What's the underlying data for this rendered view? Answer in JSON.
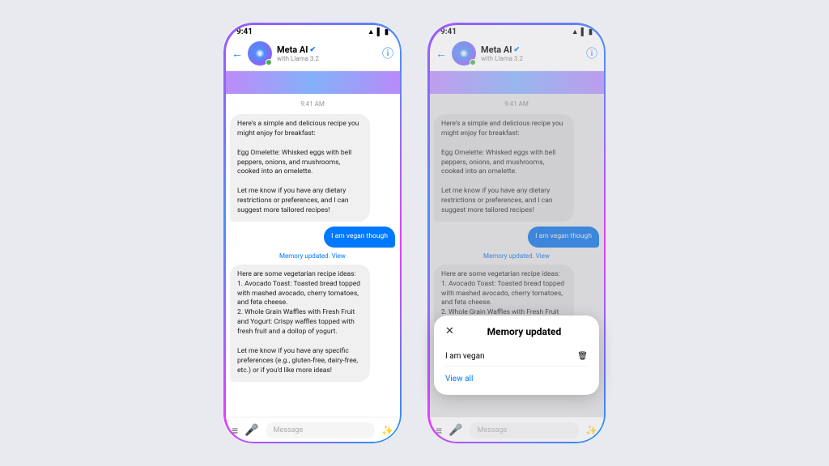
{
  "left_phone": {
    "status_time": "9:41",
    "header": {
      "name": "Meta AI",
      "sub": "with Llama 3.2",
      "back_label": "←",
      "info_label": "ⓘ"
    },
    "timestamp": "9:41 AM",
    "ai_message1": "Here's a simple and delicious recipe you might enjoy for breakfast:\n\nEgg Omelette: Whisked eggs with bell peppers, onions, and mushrooms, cooked into an omelette.\n\nLet me know if you have any dietary restrictions or preferences, and I can suggest more tailored recipes!",
    "user_message": "I am vegan though",
    "memory_note": "Memory updated.",
    "memory_view": "View",
    "ai_message2": "Here are some vegetarian recipe ideas:\n1. Avocado Toast: Toasted bread topped with mashed avocado, cherry tomatoes, and feta cheese.\n2. Whole Grain Waffles with Fresh Fruit and Yogurt: Crispy waffles topped with fresh fruit and a dollop of yogurt.\n\nLet me know if you have any specific preferences (e.g., gluten-free, dairy-free, etc.) or if you'd like more ideas!",
    "input_placeholder": "Message"
  },
  "right_phone": {
    "status_time": "9:41",
    "header": {
      "name": "Meta AI",
      "sub": "with Llama 3.2",
      "back_label": "←",
      "info_label": "ⓘ"
    },
    "timestamp": "9:41 AM",
    "ai_message1": "Here's a simple and delicious recipe you might enjoy for breakfast:\n\nEgg Omelette: Whisked eggs with bell peppers, onions, and mushrooms, cooked into an omelette.\n\nLet me know if you have any dietary restrictions or preferences, and I can suggest more tailored recipes!",
    "user_message": "I am vegan though",
    "memory_note": "Memory updated.",
    "memory_view": "View",
    "ai_message2": "Here are some vegetarian recipe ideas:\n1. Avocado Toast: Toasted bread topped with mashed avocado, cherry tomatoes, and feta cheese.\n2. Whole Grain Waffles with Fresh Fruit",
    "input_placeholder": "Message",
    "popup": {
      "title": "Memory updated",
      "close_label": "✕",
      "item": "I am vegan",
      "delete_icon": "🗑",
      "viewall_label": "View all"
    }
  },
  "icons": {
    "back": "←",
    "menu": "≡",
    "mic": "🎤",
    "sparkle": "✨",
    "wifi": "▲",
    "signal": "▌▌▌",
    "battery": "▮"
  }
}
